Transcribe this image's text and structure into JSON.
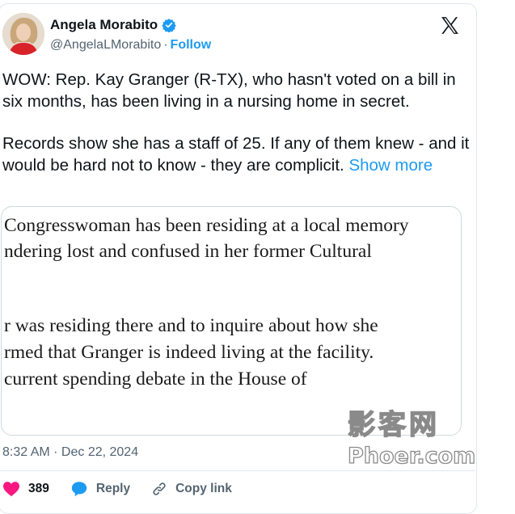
{
  "author": {
    "name": "Angela Morabito",
    "handle": "@AngelaLMorabito",
    "separator": "·",
    "follow_label": "Follow"
  },
  "tweet": {
    "paragraph1": "WOW: Rep. Kay Granger (R-TX), who hasn't voted on a bill in six months, has been living in a nursing home in secret.",
    "paragraph2": "Records show she has a staff of 25. If any of them knew - and it would be hard not to know - they are complicit.",
    "show_more": "Show more"
  },
  "media": {
    "lines": [
      "Congresswoman has been residing at a local memory",
      "ndering lost and confused in her former Cultural",
      "r was residing there and to inquire about how she",
      "rmed that Granger is indeed living at the facility.",
      "current spending debate in the House of"
    ]
  },
  "timestamp": "8:32 AM · Dec 22, 2024",
  "actions": {
    "likes": "389",
    "reply_label": "Reply",
    "copy_link_label": "Copy link"
  },
  "watermark": {
    "top": "影客网",
    "bottom": "Phoer.com"
  },
  "colors": {
    "accent": "#1d9bf0",
    "like": "#f91880",
    "muted": "#536471",
    "text": "#0f1419"
  }
}
